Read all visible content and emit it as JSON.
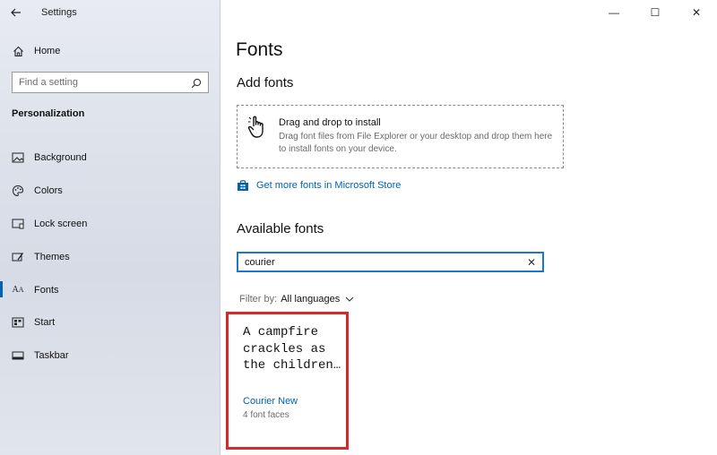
{
  "window": {
    "app_title": "Settings",
    "controls": {
      "minimize": "—",
      "maximize": "☐",
      "close": "✕"
    }
  },
  "sidebar": {
    "home_label": "Home",
    "search_placeholder": "Find a setting",
    "section_title": "Personalization",
    "items": [
      {
        "label": "Background",
        "icon": "picture-icon",
        "active": false
      },
      {
        "label": "Colors",
        "icon": "palette-icon",
        "active": false
      },
      {
        "label": "Lock screen",
        "icon": "lock-screen-icon",
        "active": false
      },
      {
        "label": "Themes",
        "icon": "brush-icon",
        "active": false
      },
      {
        "label": "Fonts",
        "icon": "font-icon",
        "active": true
      },
      {
        "label": "Start",
        "icon": "start-icon",
        "active": false
      },
      {
        "label": "Taskbar",
        "icon": "taskbar-icon",
        "active": false
      }
    ]
  },
  "main": {
    "page_title": "Fonts",
    "add_fonts_heading": "Add fonts",
    "drop_zone": {
      "title": "Drag and drop to install",
      "description": "Drag font files from File Explorer or your desktop and drop them here to install fonts on your device."
    },
    "store_link": "Get more fonts in Microsoft Store",
    "available_heading": "Available fonts",
    "font_search_value": "courier",
    "filter_label": "Filter by:",
    "filter_value": "All languages",
    "font_card": {
      "sample_text": "A campfire crackles as the children…",
      "font_name": "Courier New",
      "font_faces": "4 font faces"
    }
  },
  "colors": {
    "accent": "#0063b1",
    "highlight_border": "#d12b2b",
    "search_focus": "#1d77c8"
  }
}
